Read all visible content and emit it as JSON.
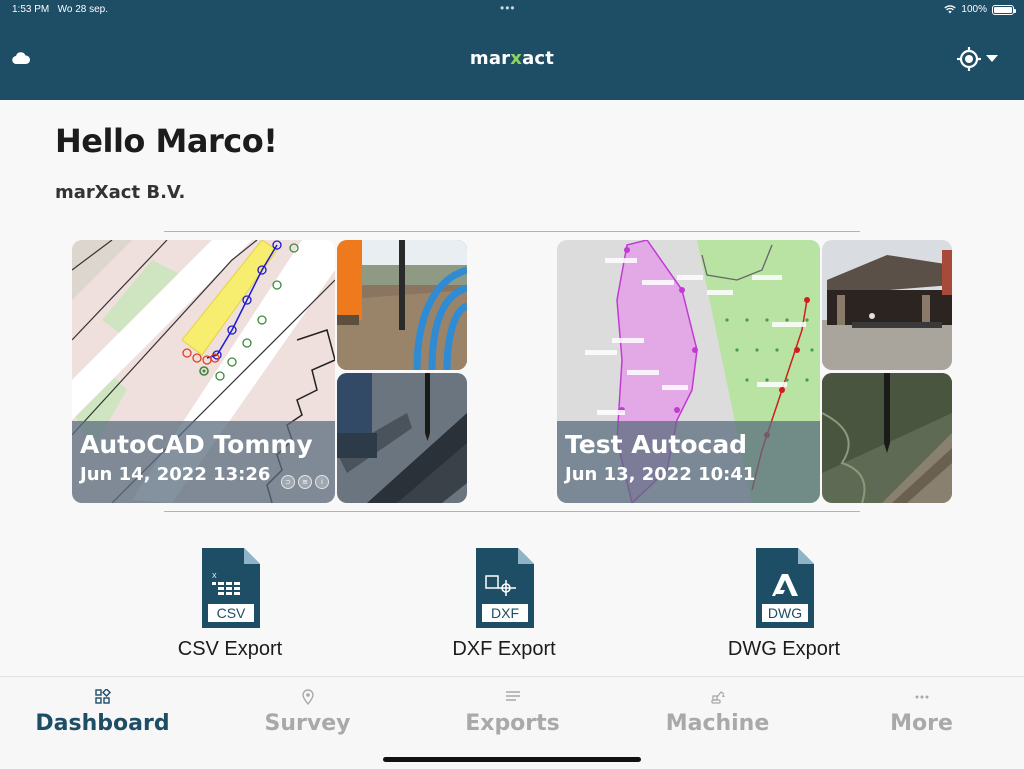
{
  "status_bar": {
    "time": "1:53 PM",
    "date": "Wo 28 sep.",
    "battery": "100%"
  },
  "header": {
    "brand_prefix": "mar",
    "brand_x": "x",
    "brand_suffix": "act",
    "left_icon": "cloud-icon",
    "right_icon": "gps-target-icon"
  },
  "greeting": "Hello Marco!",
  "company": "marXact B.V.",
  "projects": [
    {
      "title": "AutoCAD Tommy",
      "date": "Jun 14, 2022 13:26"
    },
    {
      "title": "Test Autocad",
      "date": "Jun 13, 2022 10:41"
    }
  ],
  "exports": [
    {
      "label": "CSV Export",
      "file_label": "CSV",
      "icon": "csv-file-icon"
    },
    {
      "label": "DXF Export",
      "file_label": "DXF",
      "icon": "dxf-file-icon"
    },
    {
      "label": "DWG Export",
      "file_label": "DWG",
      "icon": "dwg-file-icon"
    }
  ],
  "tabs": [
    {
      "label": "Dashboard",
      "icon": "dashboard-icon",
      "active": true
    },
    {
      "label": "Survey",
      "icon": "location-pin-icon"
    },
    {
      "label": "Exports",
      "icon": "list-icon"
    },
    {
      "label": "Machine",
      "icon": "excavator-icon"
    },
    {
      "label": "More",
      "icon": "more-dots-icon"
    }
  ],
  "colors": {
    "header_bg": "#1e4d66",
    "accent_green": "#8fd45a",
    "active_tab": "#1e4d66",
    "inactive_tab": "#a9a9a9"
  }
}
